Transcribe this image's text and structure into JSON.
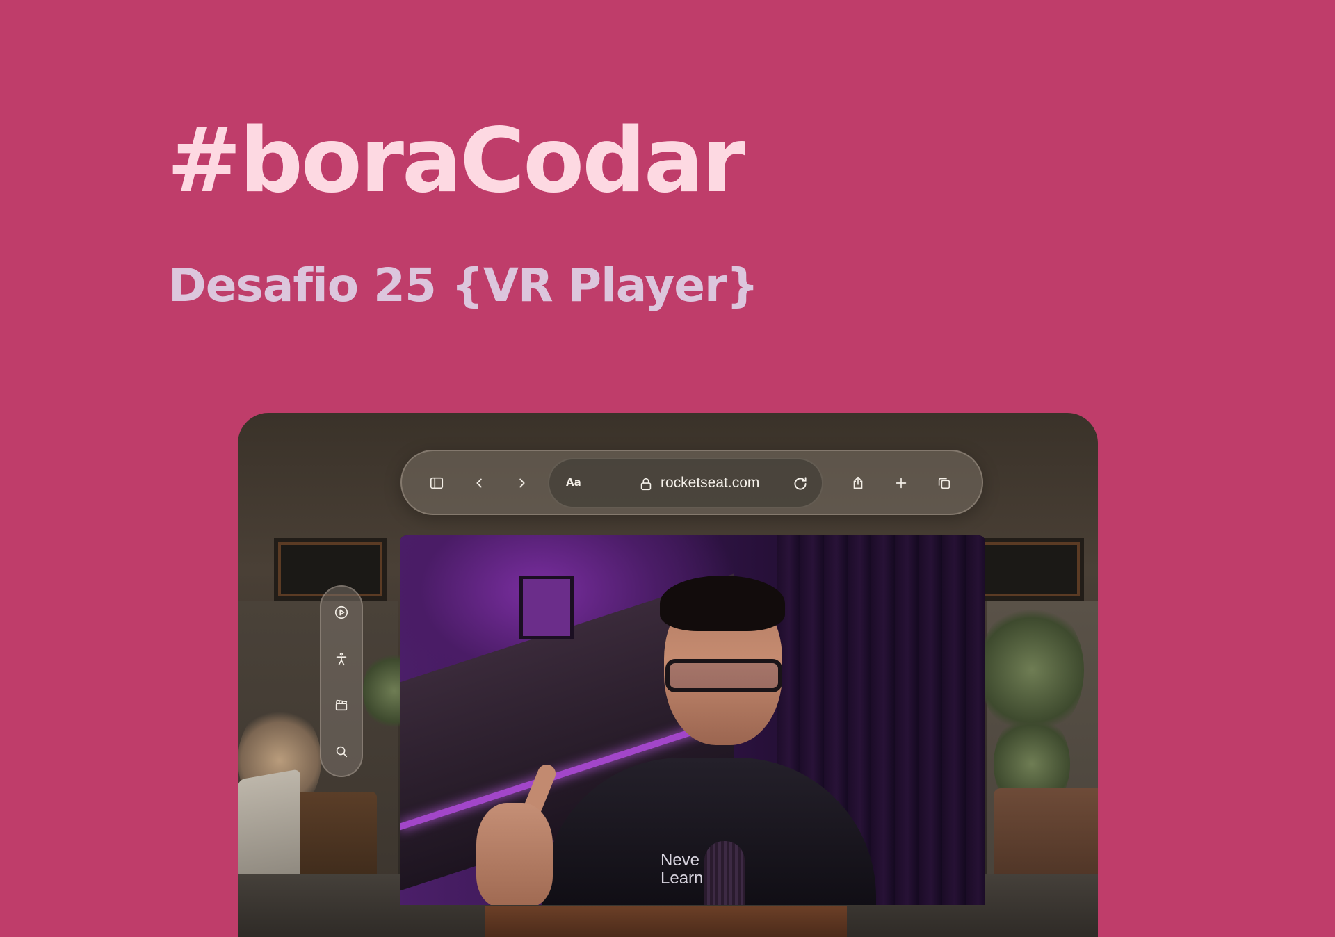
{
  "header": {
    "title": "#boraCodar",
    "subtitle": "Desafio 25 {VR Player}"
  },
  "browser": {
    "toolbar_icons": [
      "sidebar-toggle-icon",
      "chevron-left-icon",
      "chevron-right-icon",
      "share-icon",
      "plus-icon",
      "tabs-overview-icon"
    ],
    "reader_label": "Aa",
    "url": "rocketseat.com",
    "lock_icon": "lock-icon",
    "reload_icon": "reload-icon"
  },
  "video": {
    "shirt_text": "Neve\nLearn"
  },
  "sidebar": {
    "items": [
      {
        "icon": "play-circle-icon"
      },
      {
        "icon": "accessibility-icon"
      },
      {
        "icon": "clapperboard-icon"
      },
      {
        "icon": "search-icon"
      }
    ]
  },
  "colors": {
    "background": "#bf3d6a",
    "title": "#fdd9e2",
    "subtitle": "#dcc6dd"
  }
}
